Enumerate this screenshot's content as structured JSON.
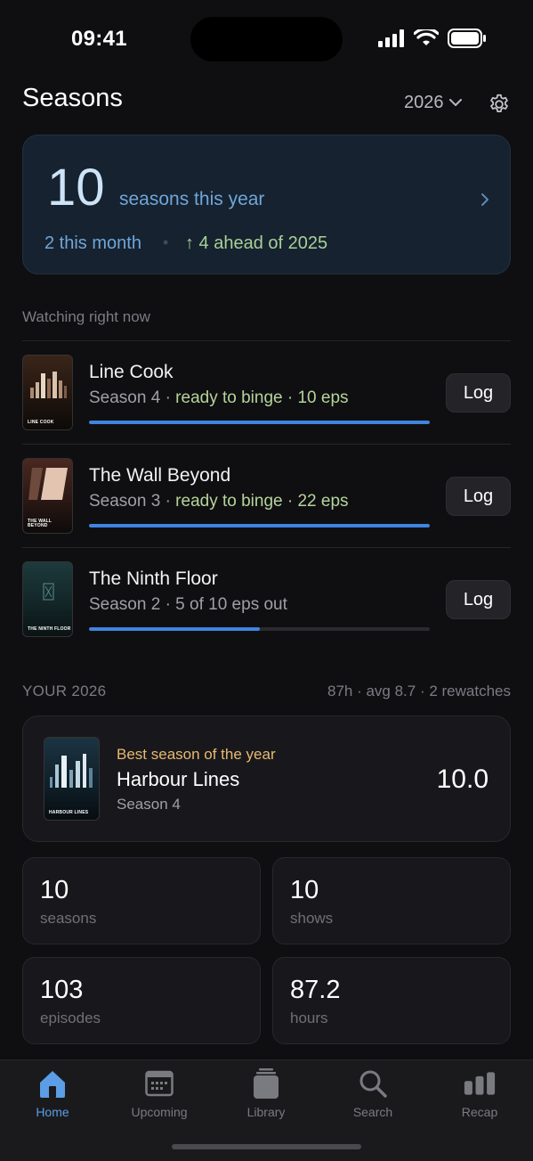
{
  "status_bar": {
    "time": "09:41"
  },
  "header": {
    "title": "Seasons",
    "year": "2026"
  },
  "summary": {
    "count": "10",
    "count_label": "seasons this year",
    "this_month": "2 this month",
    "separator": "•",
    "ahead": "↑ 4 ahead of 2025"
  },
  "watching": {
    "label": "Watching right now",
    "items": [
      {
        "title": "Line Cook",
        "season": "Season 4 · ",
        "status": "ready to binge · 10 eps",
        "status_highlight": true,
        "progress": 1.0,
        "log_label": "Log",
        "poster_text": "LINE COOK"
      },
      {
        "title": "The Wall Beyond",
        "season": "Season 3 · ",
        "status": "ready to binge · 22 eps",
        "status_highlight": true,
        "progress": 1.0,
        "log_label": "Log",
        "poster_text": "THE WALL BEYOND"
      },
      {
        "title": "The Ninth Floor",
        "season": "Season 2 · ",
        "status": "5 of 10 eps out",
        "status_highlight": false,
        "progress": 0.5,
        "log_label": "Log",
        "poster_text": "THE NINTH FLOOR"
      }
    ]
  },
  "year_summary": {
    "label": "YOUR 2026",
    "stats": "87h · avg 8.7 · 2 rewatches",
    "best": {
      "kicker": "Best season of the year",
      "title": "Harbour Lines",
      "season": "Season 4",
      "score": "10.0",
      "poster_text": "HARBOUR LINES"
    },
    "tiles": [
      {
        "value": "10",
        "label": "seasons"
      },
      {
        "value": "10",
        "label": "shows"
      },
      {
        "value": "103",
        "label": "episodes"
      },
      {
        "value": "87.2",
        "label": "hours"
      }
    ]
  },
  "tab_bar": {
    "tabs": [
      {
        "label": "Home",
        "icon": "home-icon",
        "active": true
      },
      {
        "label": "Upcoming",
        "icon": "calendar-icon",
        "active": false
      },
      {
        "label": "Library",
        "icon": "library-icon",
        "active": false
      },
      {
        "label": "Search",
        "icon": "search-icon",
        "active": false
      },
      {
        "label": "Recap",
        "icon": "bar-chart-icon",
        "active": false
      }
    ]
  },
  "colors": {
    "accent": "#3f84e0",
    "highlight": "#b5d49b",
    "gold": "#e8b870"
  }
}
